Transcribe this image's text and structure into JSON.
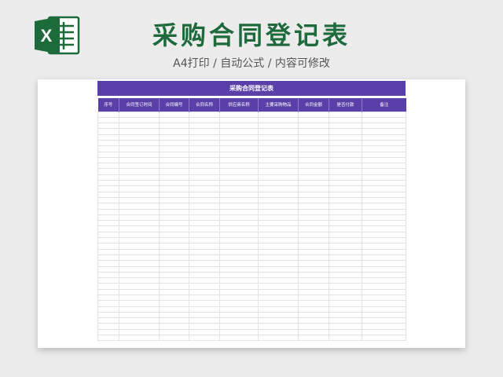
{
  "header": {
    "title": "采购合同登记表",
    "subtitle": "A4打印 / 自动公式 / 内容可修改"
  },
  "logo": {
    "icon": "excel-icon",
    "letter": "X",
    "colors": {
      "dark": "#1d6b3a",
      "light": "#2f9a57",
      "page": "#ffffff"
    }
  },
  "sheet": {
    "title": "采购合同登记表",
    "columns": [
      "序号",
      "合同签订时间",
      "合同编号",
      "合同名称",
      "供应商名称",
      "主要采购物品",
      "合同金额",
      "是否付款",
      "备注"
    ],
    "colors": {
      "header_bg": "#5a3fa8",
      "header_text": "#ffffff",
      "grid": "#e2e2e2"
    }
  }
}
